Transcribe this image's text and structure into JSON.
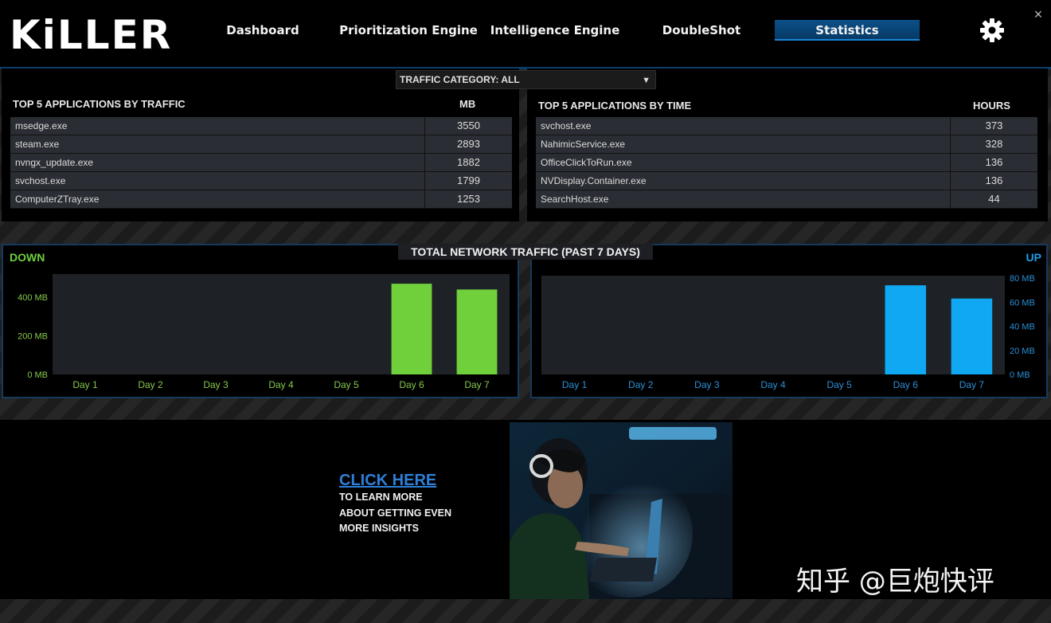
{
  "app": {
    "logo": "KiLLER"
  },
  "nav": {
    "items": [
      {
        "label": "Dashboard"
      },
      {
        "label": "Prioritization Engine"
      },
      {
        "label": "Intelligence Engine"
      },
      {
        "label": "DoubleShot"
      },
      {
        "label": "Statistics"
      }
    ],
    "active": "Statistics",
    "settings_icon": "gear-icon",
    "close_glyph": "×"
  },
  "filter": {
    "label": "TRAFFIC CATEGORY: ALL"
  },
  "traffic_table": {
    "title": "TOP 5 APPLICATIONS BY TRAFFIC",
    "unit_header": "MB",
    "rows": [
      {
        "name": "msedge.exe",
        "value": "3550"
      },
      {
        "name": "steam.exe",
        "value": "2893"
      },
      {
        "name": "nvngx_update.exe",
        "value": "1882"
      },
      {
        "name": "svchost.exe",
        "value": "1799"
      },
      {
        "name": "ComputerZTray.exe",
        "value": "1253"
      }
    ]
  },
  "time_table": {
    "title": "TOP 5 APPLICATIONS BY TIME",
    "unit_header": "HOURS",
    "rows": [
      {
        "name": "svchost.exe",
        "value": "373"
      },
      {
        "name": "NahimicService.exe",
        "value": "328"
      },
      {
        "name": "OfficeClickToRun.exe",
        "value": "136"
      },
      {
        "name": "NVDisplay.Container.exe",
        "value": "136"
      },
      {
        "name": "SearchHost.exe",
        "value": "44"
      }
    ]
  },
  "charts_title": "TOTAL NETWORK TRAFFIC (PAST  7  DAYS)",
  "chart_data": [
    {
      "type": "bar",
      "title": "DOWN",
      "categories": [
        "Day 1",
        "Day 2",
        "Day 3",
        "Day 4",
        "Day 5",
        "Day 6",
        "Day 7"
      ],
      "values": [
        0,
        0,
        0,
        0,
        0,
        470,
        440
      ],
      "ylim": [
        0,
        520
      ],
      "yticks": [
        0,
        200,
        400
      ],
      "ytick_labels": [
        "0 MB",
        "200 MB",
        "400 MB"
      ],
      "color": "#6fd03c",
      "label_color": "#86c94a",
      "axis_side": "left"
    },
    {
      "type": "bar",
      "title": "UP",
      "categories": [
        "Day 1",
        "Day 2",
        "Day 3",
        "Day 4",
        "Day 5",
        "Day 6",
        "Day 7"
      ],
      "values": [
        0,
        0,
        0,
        0,
        0,
        74,
        63
      ],
      "ylim": [
        0,
        82
      ],
      "yticks": [
        0,
        20,
        40,
        60,
        80
      ],
      "ytick_labels": [
        "0 MB",
        "20 MB",
        "40 MB",
        "60 MB",
        "80 MB"
      ],
      "color": "#10a8f2",
      "label_color": "#2b8fd6",
      "axis_side": "right"
    }
  ],
  "promo": {
    "link": "CLICK HERE",
    "lines": [
      "TO LEARN MORE",
      "ABOUT GETTING EVEN",
      "MORE INSIGHTS"
    ]
  },
  "watermark": "知乎 @巨炮快评",
  "colors": {
    "accent_blue": "#0b4f87",
    "down_green": "#6fd03c",
    "up_blue": "#10a8f2"
  }
}
